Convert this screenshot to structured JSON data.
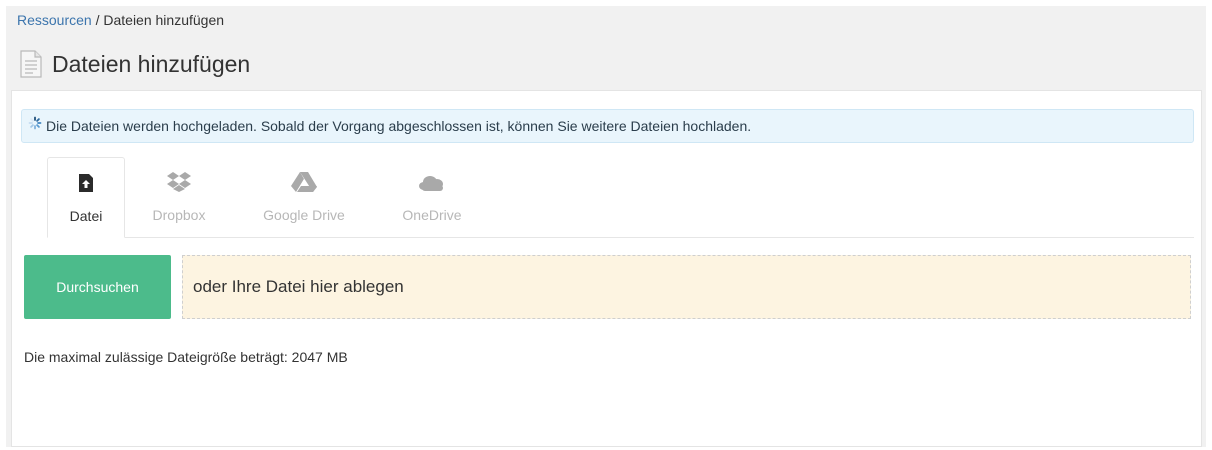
{
  "breadcrumb": {
    "link": "Ressourcen",
    "separator": " / ",
    "current": "Dateien hinzufügen"
  },
  "header": {
    "title": "Dateien hinzufügen",
    "icon": "document-icon"
  },
  "alert": {
    "icon": "spinner-icon",
    "text": "Die Dateien werden hochgeladen. Sobald der Vorgang abgeschlossen ist, können Sie weitere Dateien hochladen."
  },
  "tabs": [
    {
      "label": "Datei",
      "icon": "file-upload-icon",
      "active": true
    },
    {
      "label": "Dropbox",
      "icon": "dropbox-icon",
      "active": false
    },
    {
      "label": "Google Drive",
      "icon": "google-drive-icon",
      "active": false
    },
    {
      "label": "OneDrive",
      "icon": "onedrive-icon",
      "active": false
    }
  ],
  "upload": {
    "browse_label": "Durchsuchen",
    "drop_text": "oder Ihre Datei hier ablegen"
  },
  "limits": {
    "max_size_text": "Die maximal zulässige Dateigröße beträgt: 2047 MB"
  },
  "colors": {
    "accent_green": "#4cbb8b",
    "link_blue": "#3c75ad",
    "alert_bg": "#e9f5fc",
    "dropzone_bg": "#fdf4e1"
  }
}
